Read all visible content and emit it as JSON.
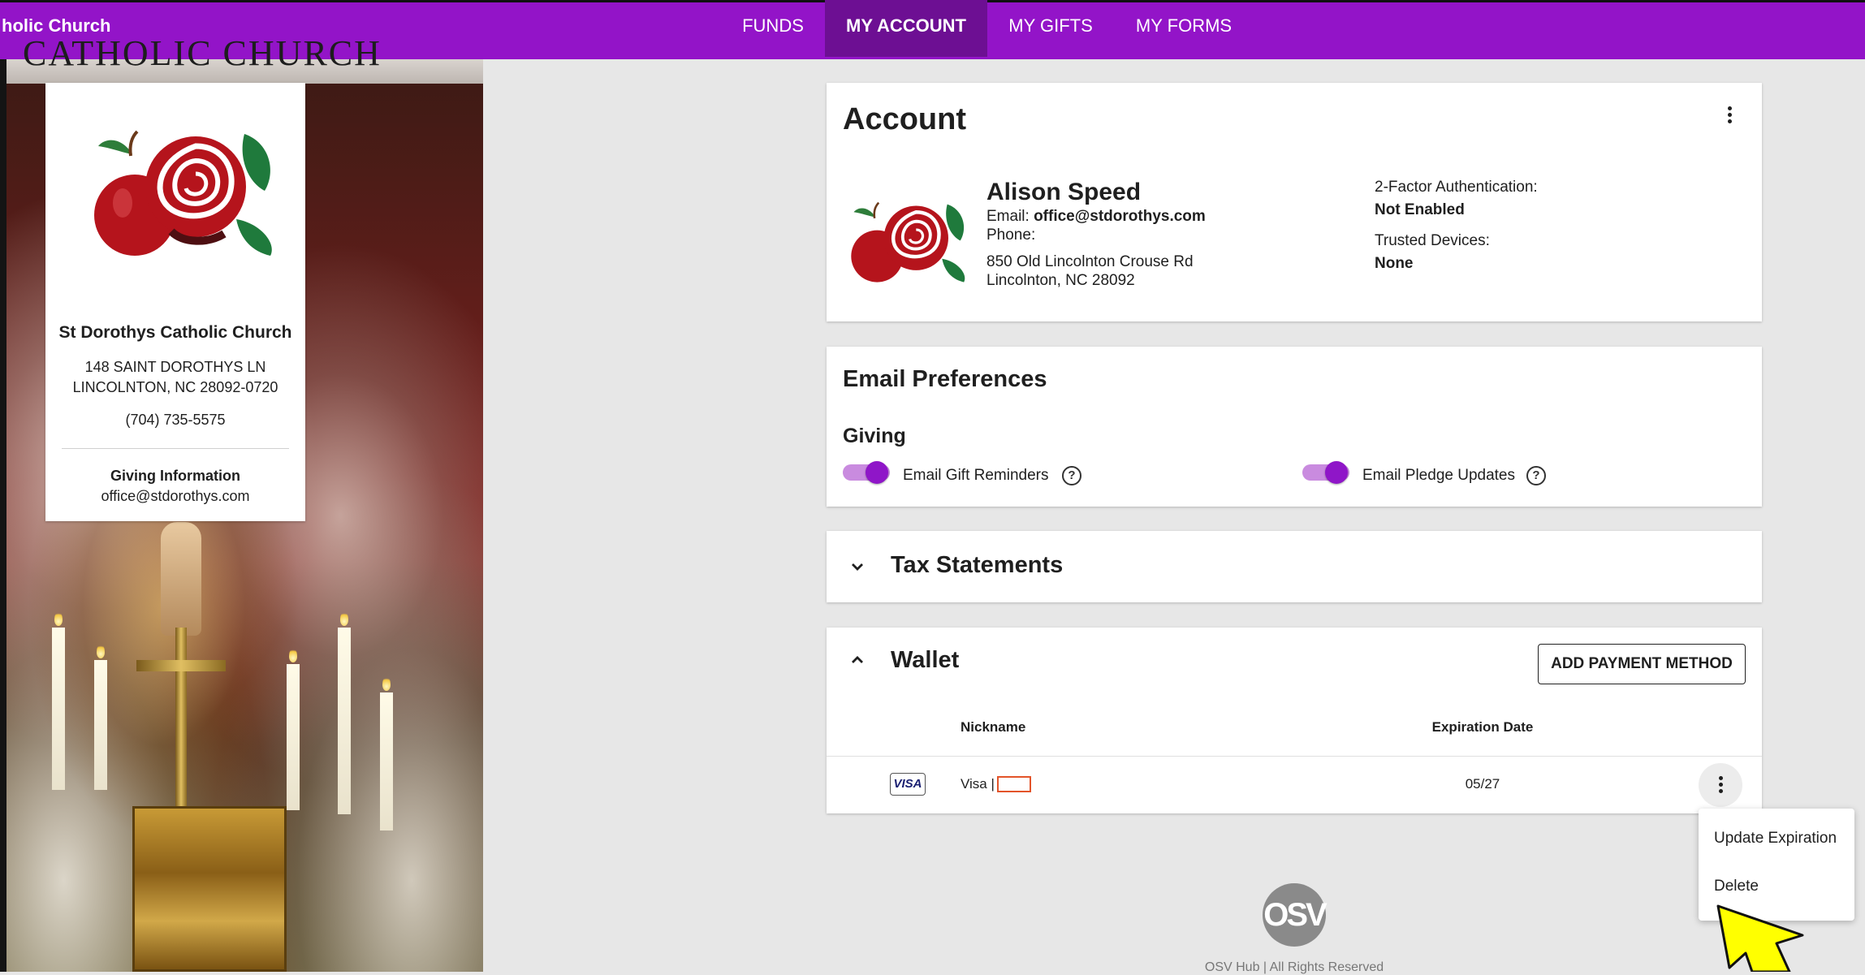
{
  "nav": {
    "brand": "holic Church",
    "items": [
      "FUNDS",
      "MY ACCOUNT",
      "MY GIFTS",
      "MY FORMS"
    ],
    "active": "MY ACCOUNT"
  },
  "banner": {
    "logo_text": "CATHOLIC CHURCH"
  },
  "church": {
    "name": "St Dorothys Catholic Church",
    "address_line1": "148 SAINT DOROTHYS LN",
    "address_line2": "LINCOLNTON, NC 28092-0720",
    "phone": "(704) 735-5575",
    "giving_label": "Giving Information",
    "giving_email": "office@stdorothys.com"
  },
  "account": {
    "title": "Account",
    "user_name": "Alison Speed",
    "email_label": "Email:",
    "email": "office@stdorothys.com",
    "phone_label": "Phone:",
    "address_line1": "850 Old Lincolnton Crouse Rd",
    "address_line2": "Lincolnton, NC 28092",
    "twofa_label": "2-Factor Authentication:",
    "twofa_value": "Not Enabled",
    "trusted_label": "Trusted Devices:",
    "trusted_value": "None"
  },
  "email_prefs": {
    "title": "Email Preferences",
    "section": "Giving",
    "toggle1_label": "Email Gift Reminders",
    "toggle2_label": "Email Pledge Updates",
    "help_glyph": "?",
    "toggle1_on": true,
    "toggle2_on": true
  },
  "tax": {
    "title": "Tax Statements",
    "chevron": "chevron-down-icon"
  },
  "wallet": {
    "title": "Wallet",
    "chevron": "chevron-up-icon",
    "add_button": "ADD PAYMENT METHOD",
    "col_nickname": "Nickname",
    "col_expiration": "Expiration Date",
    "rows": [
      {
        "brand": "VISA",
        "nickname": "Visa |",
        "expiration": "05/27"
      }
    ]
  },
  "row_menu": {
    "items": [
      "Update Expiration",
      "Delete"
    ]
  },
  "footer": {
    "logo_text": "OSV",
    "text": "OSV Hub | All Rights Reserved"
  },
  "colors": {
    "brand_purple": "#9314c8",
    "active_tab": "#6d0f93",
    "toggle_on": "#8f16c8",
    "pointer": "#ffff00"
  }
}
